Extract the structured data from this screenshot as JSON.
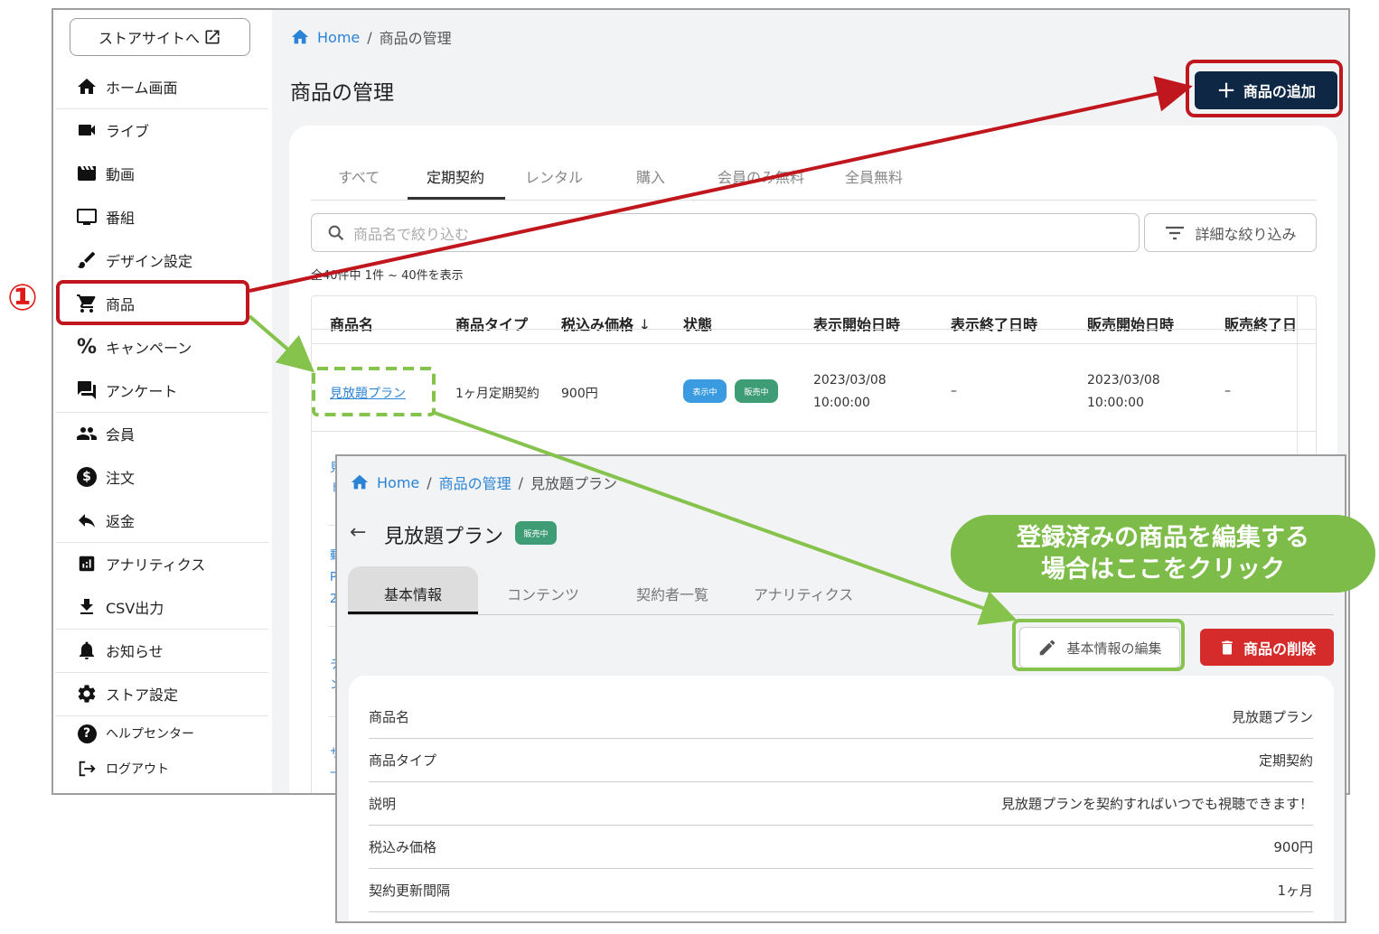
{
  "sidebar": {
    "store_button": "ストアサイトへ",
    "items": [
      {
        "label": "ホーム画面",
        "icon": "home-icon"
      },
      {
        "label": "ライブ",
        "icon": "videocam-icon"
      },
      {
        "label": "動画",
        "icon": "movie-icon"
      },
      {
        "label": "番組",
        "icon": "tv-icon"
      },
      {
        "label": "デザイン設定",
        "icon": "brush-icon"
      },
      {
        "label": "商品",
        "icon": "cart-icon"
      },
      {
        "label": "キャンペーン",
        "icon": "percent-icon"
      },
      {
        "label": "アンケート",
        "icon": "forum-icon"
      },
      {
        "label": "会員",
        "icon": "people-icon"
      },
      {
        "label": "注文",
        "icon": "dollar-icon"
      },
      {
        "label": "返金",
        "icon": "reply-icon"
      },
      {
        "label": "アナリティクス",
        "icon": "analytics-icon"
      },
      {
        "label": "CSV出力",
        "icon": "download-icon"
      },
      {
        "label": "お知らせ",
        "icon": "bell-icon"
      },
      {
        "label": "ストア設定",
        "icon": "gear-icon"
      },
      {
        "label": "ヘルプセンター",
        "icon": "help-icon"
      },
      {
        "label": "ログアウト",
        "icon": "logout-icon"
      }
    ]
  },
  "breadcrumb": {
    "home": "Home",
    "current": "商品の管理"
  },
  "page_title": "商品の管理",
  "add_button": "商品の追加",
  "tabs": [
    "すべて",
    "定期契約",
    "レンタル",
    "購入",
    "会員のみ無料",
    "全員無料"
  ],
  "search_placeholder": "商品名で絞り込む",
  "filter_button": "詳細な絞り込み",
  "result_count": "全40件中 1件 ~ 40件を表示",
  "table": {
    "headers": [
      "商品名",
      "商品タイプ",
      "税込み価格",
      "状態",
      "表示開始日時",
      "表示終了日時",
      "販売開始日時",
      "販売終了日"
    ],
    "row": {
      "name": "見放題プラン",
      "type": "1ヶ月定期契約",
      "price": "900円",
      "badge_display": "表示中",
      "badge_sale": "販売中",
      "display_start_date": "2023/03/08",
      "display_start_time": "10:00:00",
      "display_end": "–",
      "sale_start_date": "2023/03/08",
      "sale_start_time": "10:00:00",
      "sale_end": "–"
    },
    "partial_rows": [
      "見\nト",
      "動\nP\n2",
      "テ\nン",
      "サ\n一"
    ]
  },
  "detail": {
    "breadcrumb": {
      "home": "Home",
      "parent": "商品の管理",
      "current": "見放題プラン"
    },
    "title": "見放題プラン",
    "status_badge": "販売中",
    "tabs": [
      "基本情報",
      "コンテンツ",
      "契約者一覧",
      "アナリティクス"
    ],
    "edit_button": "基本情報の編集",
    "delete_button": "商品の削除",
    "rows": [
      {
        "label": "商品名",
        "value": "見放題プラン"
      },
      {
        "label": "商品タイプ",
        "value": "定期契約"
      },
      {
        "label": "説明",
        "value": "見放題プランを契約すればいつでも視聴できます！"
      },
      {
        "label": "税込み価格",
        "value": "900円"
      },
      {
        "label": "契約更新間隔",
        "value": "1ヶ月"
      }
    ]
  },
  "annotations": {
    "step_number": "①",
    "callout_line1": "登録済みの商品を編集する",
    "callout_line2": "場合はここをクリック",
    "red": "#c0161d",
    "green": "#86c34c"
  },
  "colors": {
    "navy": "#0d2745",
    "link": "#2b83d6",
    "blue_badge": "#3a9be0",
    "green_badge": "#3f9d76",
    "delete": "#d62b2b"
  }
}
